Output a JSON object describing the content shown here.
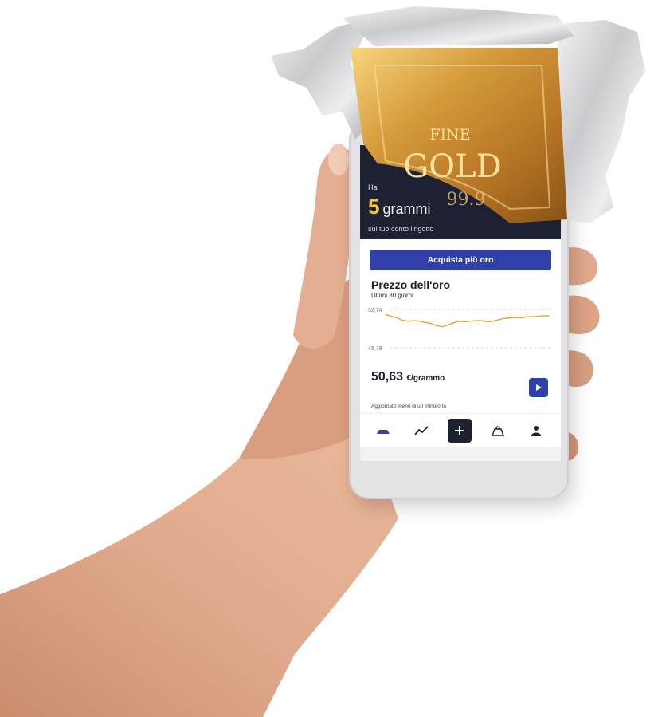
{
  "hero": {
    "label": "Hai",
    "amount": "5",
    "unit": "grammi",
    "subtitle": "sul tuo conto lingotto"
  },
  "cta": {
    "label": "Acquista più oro"
  },
  "price_card": {
    "title": "Prezzo dell'oro",
    "subtitle": "Ultimi 30 giorni",
    "value": "50,63",
    "unit": "€/grammo",
    "updated": "Aggiornato meno di un minuto fa"
  },
  "chart_data": {
    "type": "line",
    "title": "Prezzo dell'oro",
    "subtitle": "Ultimi 30 giorni",
    "ylim": [
      45.78,
      52.74
    ],
    "ytick_labels": [
      "52,74",
      "45,78"
    ],
    "x": [
      1,
      2,
      3,
      4,
      5,
      6,
      7,
      8,
      9,
      10,
      11,
      12,
      13,
      14,
      15,
      16,
      17,
      18,
      19,
      20,
      21,
      22,
      23,
      24,
      25,
      26,
      27,
      28,
      29,
      30
    ],
    "values": [
      51.8,
      51.5,
      51.2,
      50.8,
      50.6,
      50.7,
      50.6,
      50.4,
      50.2,
      49.8,
      49.6,
      49.9,
      50.3,
      50.6,
      50.5,
      50.6,
      50.7,
      50.7,
      50.5,
      50.6,
      50.9,
      51.1,
      51.2,
      51.3,
      51.2,
      51.4,
      51.4,
      51.5,
      51.6,
      51.5
    ],
    "grid": false,
    "line_color": "#e0a92b"
  },
  "bar": {
    "line1": "FINE",
    "line2": "GOLD",
    "line3": "99.9"
  },
  "tabs": [
    {
      "name": "home",
      "icon": "bar-home-icon"
    },
    {
      "name": "chart",
      "icon": "trend-icon"
    },
    {
      "name": "add",
      "icon": "plus-icon"
    },
    {
      "name": "shop",
      "icon": "bag-icon"
    },
    {
      "name": "profile",
      "icon": "user-icon"
    }
  ],
  "colors": {
    "hero": "#1e2132",
    "accent": "#2f41a8",
    "gold": "#f4c43a"
  }
}
